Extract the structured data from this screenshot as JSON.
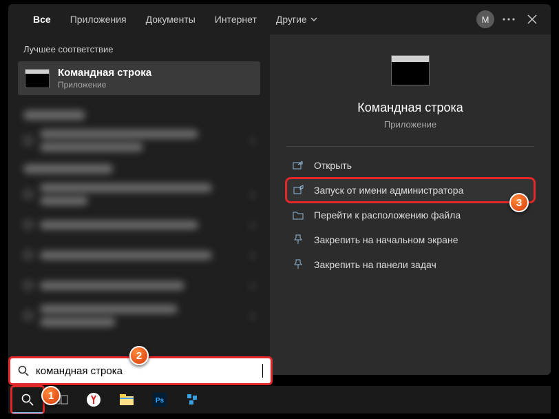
{
  "tabs": {
    "all": "Все",
    "apps": "Приложения",
    "docs": "Документы",
    "web": "Интернет",
    "other": "Другие"
  },
  "avatar_letter": "М",
  "left": {
    "best_label": "Лучшее соответствие",
    "best": {
      "title": "Командная строка",
      "sub": "Приложение"
    }
  },
  "right": {
    "title": "Командная строка",
    "sub": "Приложение",
    "actions": {
      "open": "Открыть",
      "admin": "Запуск от имени администратора",
      "loc": "Перейти к расположению файла",
      "pin_start": "Закрепить на начальном экране",
      "pin_task": "Закрепить на панели задач"
    }
  },
  "search": {
    "value": "командная строка"
  },
  "badges": {
    "b1": "1",
    "b2": "2",
    "b3": "3"
  }
}
